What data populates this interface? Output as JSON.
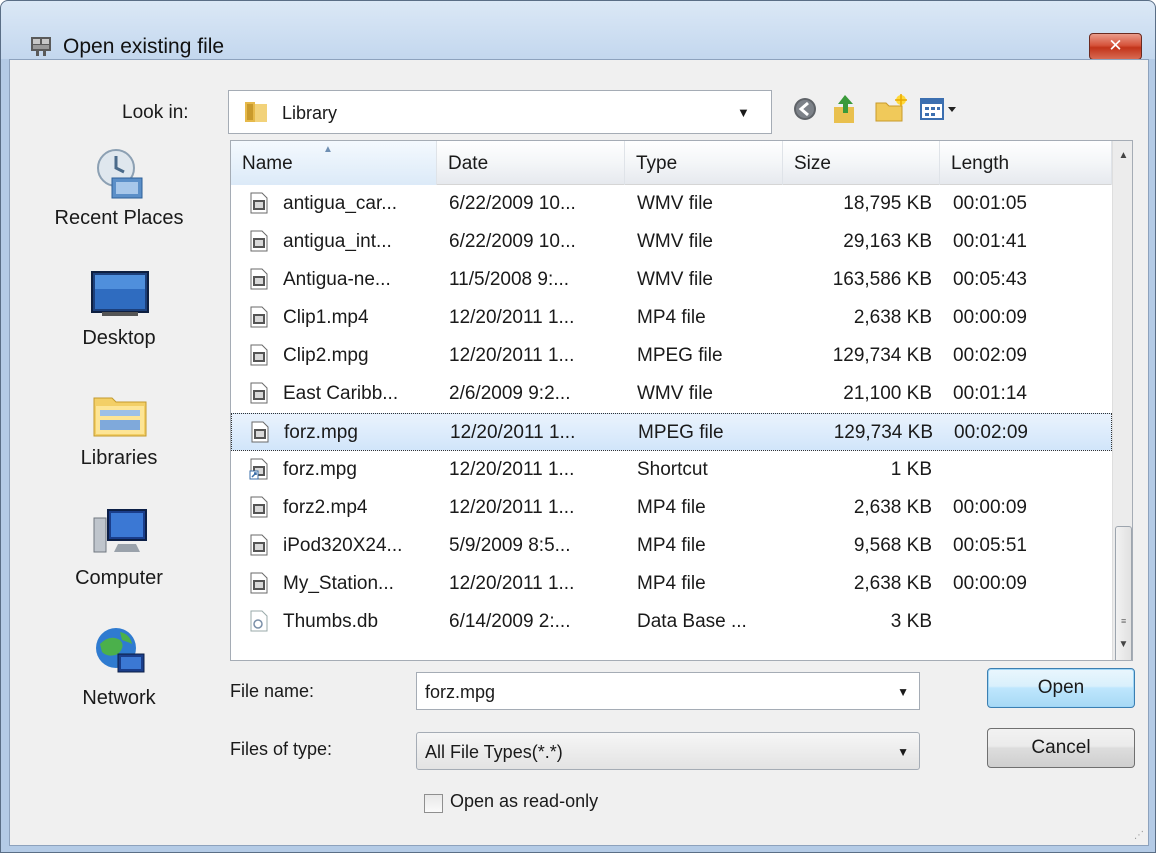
{
  "window": {
    "title": "Open existing file",
    "close_label": "✕"
  },
  "look_in": {
    "label": "Look in:",
    "value": "Library"
  },
  "toolbar": {
    "icons": [
      "back-icon",
      "up-folder-icon",
      "new-folder-icon",
      "view-menu-icon"
    ]
  },
  "places": [
    {
      "label": "Recent Places",
      "icon": "recent-places-icon"
    },
    {
      "label": "Desktop",
      "icon": "desktop-icon"
    },
    {
      "label": "Libraries",
      "icon": "libraries-icon"
    },
    {
      "label": "Computer",
      "icon": "computer-icon"
    },
    {
      "label": "Network",
      "icon": "network-icon"
    }
  ],
  "file_list": {
    "columns": [
      "Name",
      "Date",
      "Type",
      "Size",
      "Length"
    ],
    "sorted_column": "Name",
    "rows": [
      {
        "name": "antigua_car...",
        "date": "6/22/2009 10...",
        "type": "WMV file",
        "size": "18,795 KB",
        "length": "00:01:05",
        "icon": "video-file-icon"
      },
      {
        "name": "antigua_int...",
        "date": "6/22/2009 10...",
        "type": "WMV file",
        "size": "29,163 KB",
        "length": "00:01:41",
        "icon": "video-file-icon"
      },
      {
        "name": "Antigua-ne...",
        "date": "11/5/2008 9:...",
        "type": "WMV file",
        "size": "163,586 KB",
        "length": "00:05:43",
        "icon": "video-file-icon"
      },
      {
        "name": "Clip1.mp4",
        "date": "12/20/2011 1...",
        "type": "MP4 file",
        "size": "2,638 KB",
        "length": "00:00:09",
        "icon": "video-file-icon"
      },
      {
        "name": "Clip2.mpg",
        "date": "12/20/2011 1...",
        "type": "MPEG file",
        "size": "129,734 KB",
        "length": "00:02:09",
        "icon": "video-file-icon"
      },
      {
        "name": "East Caribb...",
        "date": "2/6/2009 9:2...",
        "type": "WMV file",
        "size": "21,100 KB",
        "length": "00:01:14",
        "icon": "video-file-icon"
      },
      {
        "name": "forz.mpg",
        "date": "12/20/2011 1...",
        "type": "MPEG file",
        "size": "129,734 KB",
        "length": "00:02:09",
        "icon": "video-file-icon",
        "selected": true
      },
      {
        "name": "forz.mpg",
        "date": "12/20/2011 1...",
        "type": "Shortcut",
        "size": "1 KB",
        "length": "",
        "icon": "shortcut-icon"
      },
      {
        "name": "forz2.mp4",
        "date": "12/20/2011 1...",
        "type": "MP4 file",
        "size": "2,638 KB",
        "length": "00:00:09",
        "icon": "video-file-icon"
      },
      {
        "name": "iPod320X24...",
        "date": "5/9/2009 8:5...",
        "type": "MP4 file",
        "size": "9,568 KB",
        "length": "00:05:51",
        "icon": "video-file-icon"
      },
      {
        "name": "My_Station...",
        "date": "12/20/2011 1...",
        "type": "MP4 file",
        "size": "2,638 KB",
        "length": "00:00:09",
        "icon": "video-file-icon"
      },
      {
        "name": "Thumbs.db",
        "date": "6/14/2009 2:...",
        "type": "Data Base ...",
        "size": "3 KB",
        "length": "",
        "icon": "database-file-icon"
      }
    ]
  },
  "file_name": {
    "label": "File name:",
    "value": "forz.mpg"
  },
  "file_type": {
    "label": "Files of type:",
    "value": "All File Types(*.*)"
  },
  "read_only": {
    "label": "Open as read-only",
    "checked": false
  },
  "buttons": {
    "open": "Open",
    "cancel": "Cancel"
  }
}
